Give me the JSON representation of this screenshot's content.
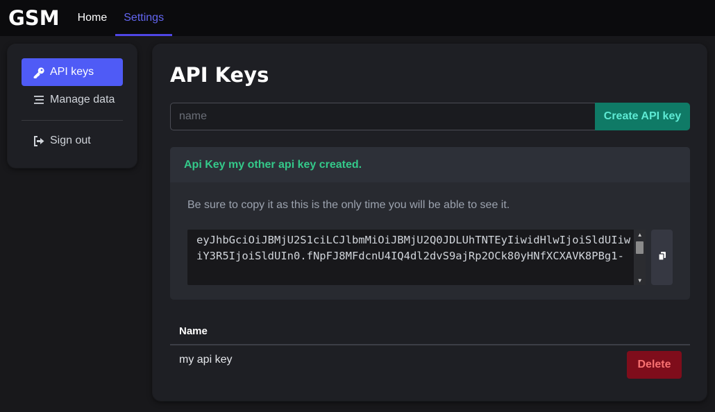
{
  "nav": {
    "logo": "GSM",
    "links": [
      {
        "label": "Home",
        "active": false
      },
      {
        "label": "Settings",
        "active": true
      }
    ]
  },
  "sidebar": {
    "items": [
      {
        "label": "API keys",
        "icon": "key-icon",
        "active": true
      },
      {
        "label": "Manage data",
        "icon": "list-icon",
        "active": false
      },
      {
        "label": "Sign out",
        "icon": "sign-out-icon",
        "active": false
      }
    ]
  },
  "main": {
    "title": "API Keys",
    "name_input": {
      "placeholder": "name",
      "value": ""
    },
    "create_button": "Create API key",
    "notice": {
      "header": "Api Key my other api key created.",
      "message": "Be sure to copy it as this is the only time you will be able to see it.",
      "api_key": "eyJhbGciOiJBMjU2S1ciLCJlbmMiOiJBMjU2Q0JDLUhTNTEyIiwidHlwIjoiSldUIiwiY3R5IjoiSldUIn0.fNpFJ8MFdcnU4IQ4dl2dvS9ajRp2OCk80yHNfXCXAVK8PBg1-"
    },
    "table": {
      "header": "Name",
      "rows": [
        {
          "name": "my api key",
          "action": "Delete"
        }
      ]
    }
  },
  "colors": {
    "accent": "#4f5bf6",
    "success": "#34c98a",
    "create_button_bg": "#0f7a66",
    "delete_button_bg": "#7f0d1b"
  }
}
